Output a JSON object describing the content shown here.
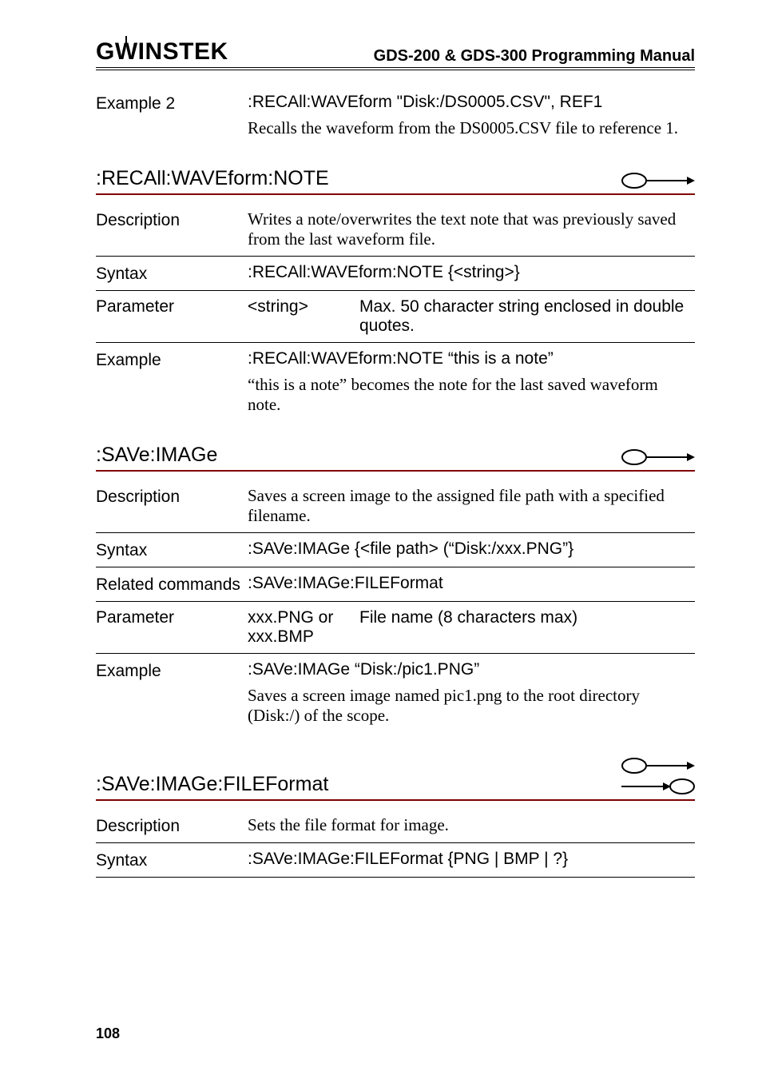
{
  "header": {
    "brand": "GWINSTEK",
    "manual_title": "GDS-200 & GDS-300 Programming Manual"
  },
  "example2": {
    "label": "Example 2",
    "cmd": ":RECAll:WAVEform \"Disk:/DS0005.CSV\", REF1",
    "desc": "Recalls the waveform from the DS0005.CSV file to reference 1."
  },
  "sec1": {
    "title": ":RECAll:WAVEform:NOTE",
    "desc_label": "Description",
    "desc_text": "Writes a note/overwrites the text note that was previously saved from the last waveform file.",
    "syntax_label": "Syntax",
    "syntax_text": ":RECAll:WAVEform:NOTE {<string>}",
    "param_label": "Parameter",
    "param_name": "<string>",
    "param_desc": "Max. 50 character string enclosed in double quotes.",
    "ex_label": "Example",
    "ex_cmd": ":RECAll:WAVEform:NOTE “this is a note”",
    "ex_desc": "“this is a note” becomes the note for the last saved waveform note."
  },
  "sec2": {
    "title": ":SAVe:IMAGe",
    "desc_label": "Description",
    "desc_text": "Saves a screen image to the assigned file path with a specified filename.",
    "syntax_label": "Syntax",
    "syntax_text": ":SAVe:IMAGe {<file path> (“Disk:/xxx.PNG”}",
    "rel_label": "Related commands",
    "rel_text": ":SAVe:IMAGe:FILEFormat",
    "param_label": "Parameter",
    "param_name": "xxx.PNG or xxx.BMP",
    "param_desc": "File name (8 characters max)",
    "ex_label": "Example",
    "ex_cmd": ":SAVe:IMAGe “Disk:/pic1.PNG”",
    "ex_desc": "Saves a screen image named pic1.png to the root directory (Disk:/) of the scope."
  },
  "sec3": {
    "title": ":SAVe:IMAGe:FILEFormat",
    "desc_label": "Description",
    "desc_text": "Sets the file format for image.",
    "syntax_label": "Syntax",
    "syntax_text": ":SAVe:IMAGe:FILEFormat {PNG | BMP | ?}"
  },
  "page_number": "108"
}
